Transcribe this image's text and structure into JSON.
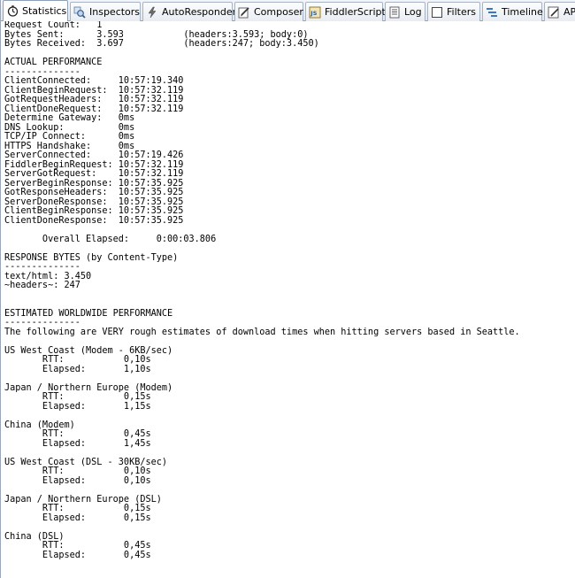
{
  "tabs": [
    {
      "label": "Statistics",
      "icon": "stopwatch-icon",
      "active": true
    },
    {
      "label": "Inspectors",
      "icon": "magnifier-icon",
      "active": false
    },
    {
      "label": "AutoResponder",
      "icon": "lightning-icon",
      "active": false
    },
    {
      "label": "Composer",
      "icon": "pencil-icon",
      "active": false
    },
    {
      "label": "FiddlerScript",
      "icon": "script-icon",
      "active": false
    },
    {
      "label": "Log",
      "icon": "log-icon",
      "active": false
    },
    {
      "label": "Filters",
      "icon": "checkbox-icon",
      "active": false
    },
    {
      "label": "Timeline",
      "icon": "timeline-icon",
      "active": false
    },
    {
      "label": "AP",
      "icon": "pen-icon",
      "active": false
    }
  ],
  "report_lines": [
    "Request Count:   1",
    "Bytes Sent:      3.593           (headers:3.593; body:0)",
    "Bytes Received:  3.697           (headers:247; body:3.450)",
    "",
    "ACTUAL PERFORMANCE",
    "--------------",
    "ClientConnected:     10:57:19.340",
    "ClientBeginRequest:  10:57:32.119",
    "GotRequestHeaders:   10:57:32.119",
    "ClientDoneRequest:   10:57:32.119",
    "Determine Gateway:   0ms",
    "DNS Lookup:          0ms",
    "TCP/IP Connect:      0ms",
    "HTTPS Handshake:     0ms",
    "ServerConnected:     10:57:19.426",
    "FiddlerBeginRequest: 10:57:32.119",
    "ServerGotRequest:    10:57:32.119",
    "ServerBeginResponse: 10:57:35.925",
    "GotResponseHeaders:  10:57:35.925",
    "ServerDoneResponse:  10:57:35.925",
    "ClientBeginResponse: 10:57:35.925",
    "ClientDoneResponse:  10:57:35.925",
    "",
    "       Overall Elapsed:     0:00:03.806",
    "",
    "RESPONSE BYTES (by Content-Type)",
    "--------------",
    "text/html: 3.450",
    "~headers~: 247",
    "",
    "",
    "ESTIMATED WORLDWIDE PERFORMANCE",
    "--------------",
    "The following are VERY rough estimates of download times when hitting servers based in Seattle.",
    "",
    "US West Coast (Modem - 6KB/sec)",
    "       RTT:           0,10s",
    "       Elapsed:       1,10s",
    "",
    "Japan / Northern Europe (Modem)",
    "       RTT:           0,15s",
    "       Elapsed:       1,15s",
    "",
    "China (Modem)",
    "       RTT:           0,45s",
    "       Elapsed:       1,45s",
    "",
    "US West Coast (DSL - 30KB/sec)",
    "       RTT:           0,10s",
    "       Elapsed:       0,10s",
    "",
    "Japan / Northern Europe (DSL)",
    "       RTT:           0,15s",
    "       Elapsed:       0,15s",
    "",
    "China (DSL)",
    "       RTT:           0,45s",
    "       Elapsed:       0,45s"
  ]
}
